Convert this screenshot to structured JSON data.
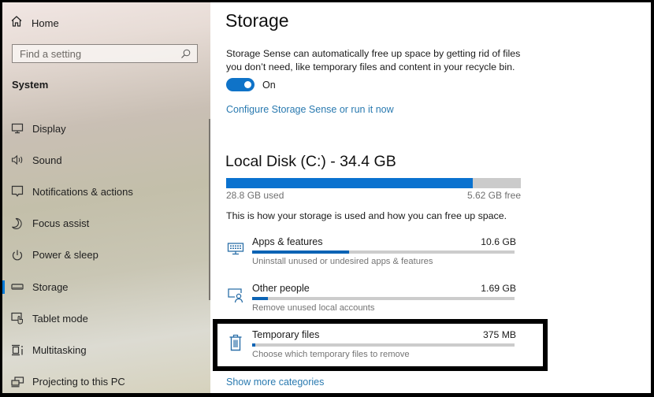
{
  "sidebar": {
    "home_label": "Home",
    "search": {
      "placeholder": "Find a setting",
      "value": ""
    },
    "section_label": "System",
    "items": [
      {
        "label": "Display",
        "icon": "monitor-icon"
      },
      {
        "label": "Sound",
        "icon": "speaker-icon"
      },
      {
        "label": "Notifications & actions",
        "icon": "notification-icon"
      },
      {
        "label": "Focus assist",
        "icon": "moon-icon"
      },
      {
        "label": "Power & sleep",
        "icon": "power-icon"
      },
      {
        "label": "Storage",
        "icon": "storage-drive-icon",
        "active": true
      },
      {
        "label": "Tablet mode",
        "icon": "tablet-mode-icon"
      },
      {
        "label": "Multitasking",
        "icon": "multitasking-icon"
      },
      {
        "label": "Projecting to this PC",
        "icon": "projecting-icon"
      }
    ]
  },
  "main": {
    "title": "Storage",
    "storage_sense": {
      "description": "Storage Sense can automatically free up space by getting rid of files you don’t need, like temporary files and content in your recycle bin.",
      "toggle_state": "On",
      "toggle_on": true,
      "configure_link": "Configure Storage Sense or run it now"
    },
    "disk": {
      "title": "Local Disk (C:) - 34.4 GB",
      "used_label": "28.8 GB used",
      "free_label": "5.62 GB free",
      "used_fraction": 0.837,
      "usage_note": "This is how your storage is used and how you can free up space."
    },
    "categories": [
      {
        "name": "Apps & features",
        "size": "10.6 GB",
        "description": "Uninstall unused or undesired apps & features",
        "fraction": 0.37,
        "icon": "apps-features-icon"
      },
      {
        "name": "Other people",
        "size": "1.69 GB",
        "description": "Remove unused local accounts",
        "fraction": 0.06,
        "icon": "other-people-icon"
      },
      {
        "name": "Temporary files",
        "size": "375 MB",
        "description": "Choose which temporary files to remove",
        "fraction": 0.013,
        "icon": "trash-icon",
        "highlighted": true
      }
    ],
    "show_more_link": "Show more categories"
  },
  "colors": {
    "accent": "#0078d7",
    "link": "#2a7ab0",
    "bar_fill": "#0a72cf",
    "bar_track": "#cbcbcb"
  }
}
